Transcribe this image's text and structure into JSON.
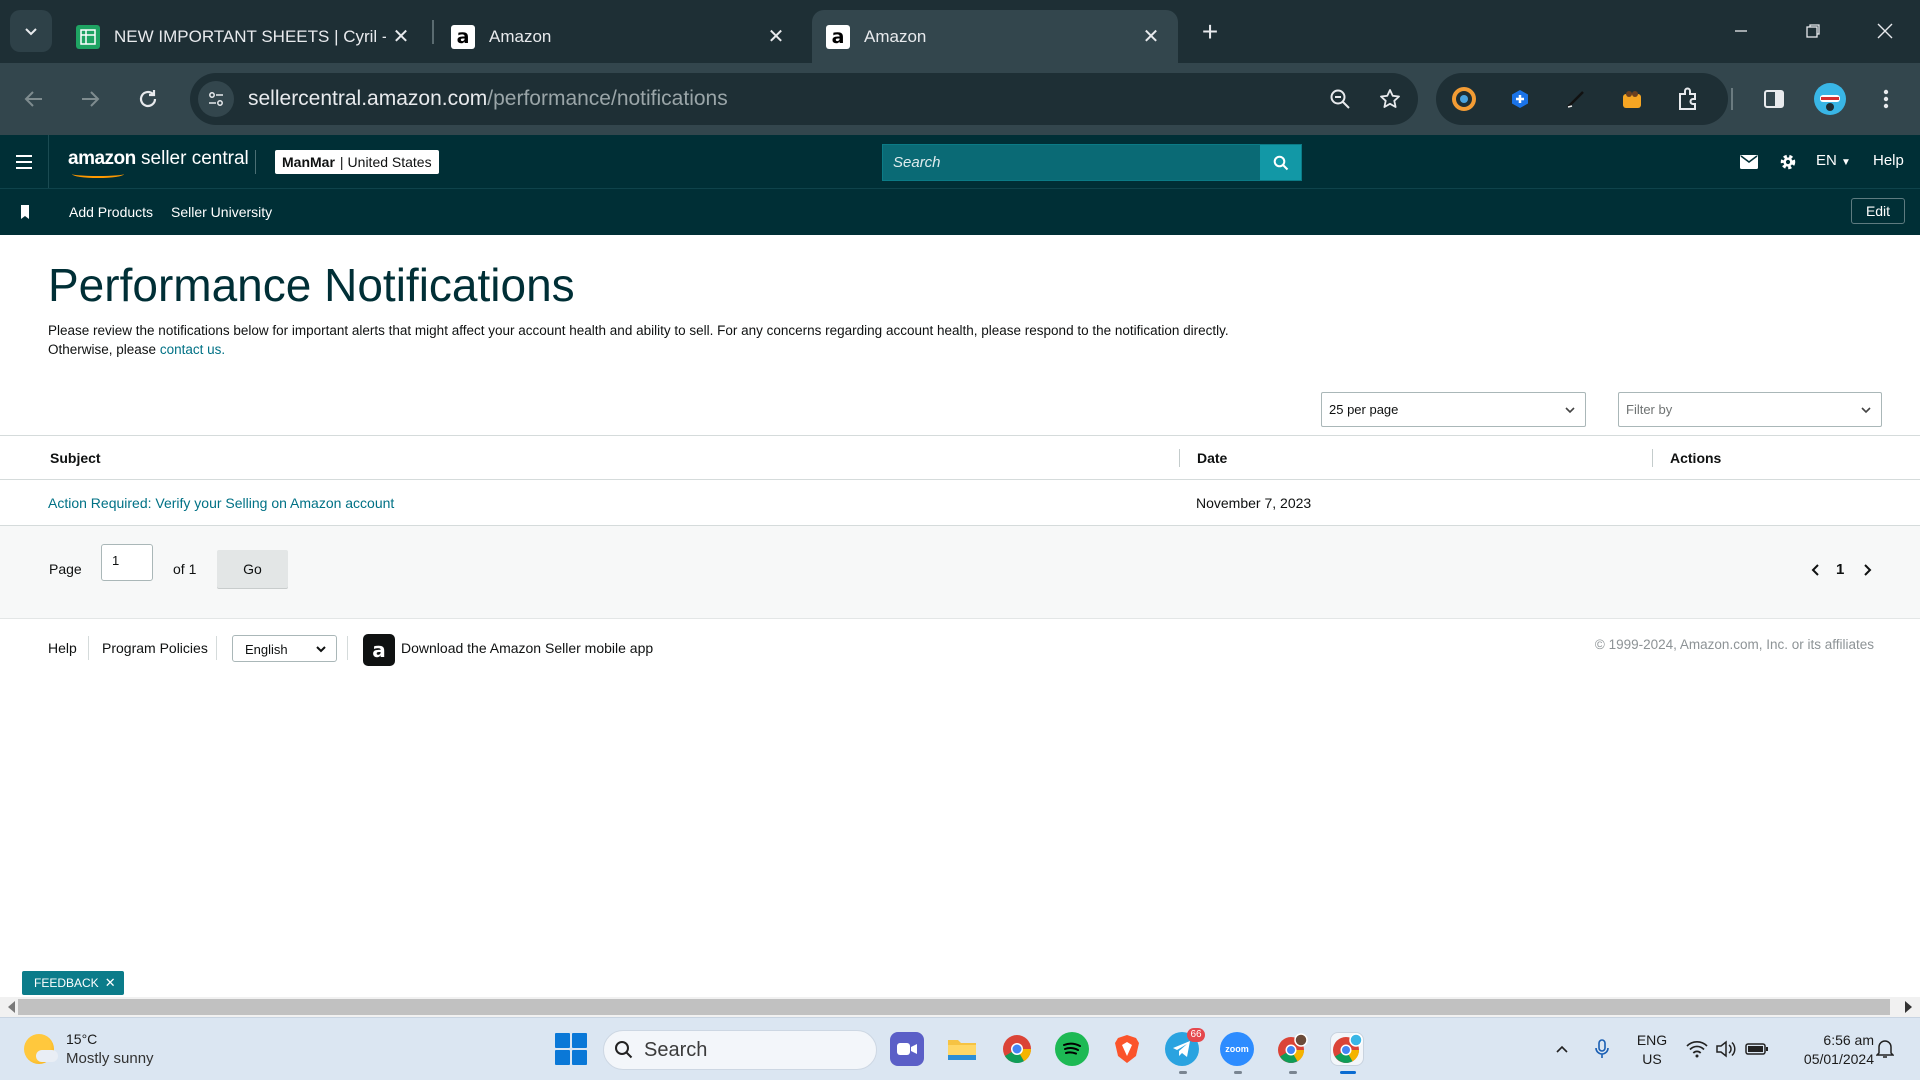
{
  "browser": {
    "tabs": [
      {
        "title": "NEW IMPORTANT SHEETS | Cyril -",
        "icon": "sheets-icon",
        "active": false
      },
      {
        "title": "Amazon",
        "icon": "amazon-icon",
        "active": false
      },
      {
        "title": "Amazon",
        "icon": "amazon-icon",
        "active": true
      }
    ],
    "url_host": "sellercentral.amazon.com",
    "url_path": "/performance/notifications"
  },
  "seller_central": {
    "logo_brand": "amazon",
    "logo_suffix": " seller central",
    "account_name": "ManMar",
    "account_separator": "|",
    "account_region": "United States",
    "search_placeholder": "Search",
    "language": "EN",
    "help": "Help",
    "nav_links": [
      "Add Products",
      "Seller University"
    ],
    "edit_label": "Edit"
  },
  "page": {
    "title": "Performance Notifications",
    "description": "Please review the notifications below for important alerts that might affect your account health and ability to sell. For any concerns regarding account health, please respond to the notification directly.",
    "description_line2_prefix": "Otherwise, please ",
    "contact_link": "contact us.",
    "per_page": "25 per page",
    "filter_placeholder": "Filter by",
    "table": {
      "headers": [
        "Subject",
        "Date",
        "Actions"
      ],
      "rows": [
        {
          "subject": "Action Required: Verify your Selling on Amazon account",
          "date": "November 7, 2023",
          "actions": ""
        }
      ]
    },
    "pager": {
      "page_label": "Page",
      "page_value": "1",
      "of_label": "of 1",
      "go_label": "Go",
      "current_page": "1"
    },
    "footer": {
      "help": "Help",
      "program_policies": "Program Policies",
      "language": "English",
      "download_app": "Download the Amazon Seller mobile app",
      "copyright": "© 1999-2024, Amazon.com, Inc. or its affiliates"
    },
    "feedback_label": "FEEDBACK"
  },
  "taskbar": {
    "weather_temp": "15°C",
    "weather_desc": "Mostly sunny",
    "search_label": "Search",
    "telegram_badge": "66",
    "lang_line1": "ENG",
    "lang_line2": "US",
    "time": "6:56 am",
    "date": "05/01/2024"
  },
  "colors": {
    "sc_header": "#002f36",
    "link": "#007185",
    "search_button": "#1298a6",
    "chrome_frame": "#1e2f35",
    "chrome_toolbar": "#33464d"
  }
}
